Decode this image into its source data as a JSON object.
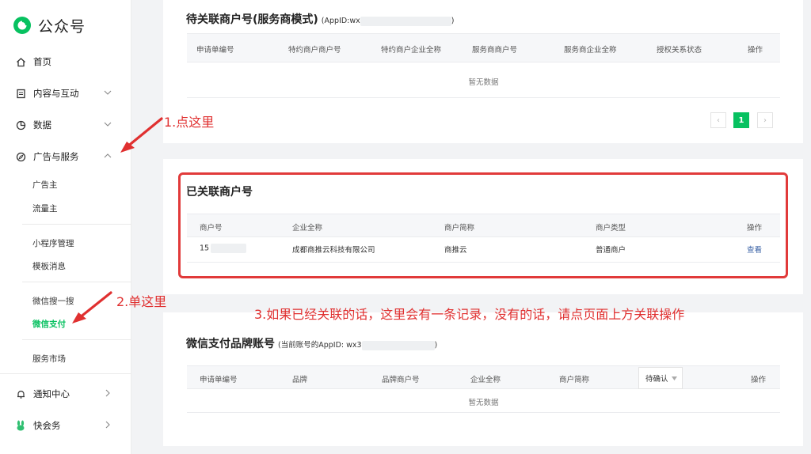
{
  "app": {
    "name": "公众号"
  },
  "sidebar": {
    "items": [
      {
        "label": "首页"
      },
      {
        "label": "内容与互动"
      },
      {
        "label": "数据"
      },
      {
        "label": "广告与服务"
      },
      {
        "label": "通知中心"
      },
      {
        "label": "快会务"
      }
    ],
    "sub_items": [
      {
        "label": "广告主"
      },
      {
        "label": "流量主"
      },
      {
        "label": "小程序管理"
      },
      {
        "label": "模板消息"
      },
      {
        "label": "微信搜一搜"
      },
      {
        "label": "微信支付"
      },
      {
        "label": "服务市场"
      }
    ]
  },
  "pending": {
    "title": "待关联商户号(服务商模式)",
    "note": "(AppID:wx",
    "note_end": ")",
    "columns": [
      "申请单编号",
      "特约商户商户号",
      "特约商户企业全称",
      "服务商商户号",
      "服务商企业全称",
      "授权关系状态",
      "操作"
    ],
    "empty": "暂无数据",
    "pager": {
      "prev": "‹",
      "current": "1",
      "next": "›"
    }
  },
  "linked": {
    "title": "已关联商户号",
    "columns": [
      "商户号",
      "企业全称",
      "商户简称",
      "商户类型",
      "操作"
    ],
    "rows": [
      {
        "merchant_id": "15",
        "company": "成都商推云科技有限公司",
        "short_name": "商推云",
        "type": "普通商户",
        "action": "查看"
      }
    ]
  },
  "brand": {
    "title": "微信支付品牌账号",
    "note": "(当前账号的AppID: wx3",
    "note_end": ")",
    "columns": [
      "申请单编号",
      "品牌",
      "品牌商户号",
      "企业全称",
      "商户简称",
      "操作"
    ],
    "filter": "待确认",
    "empty": "暂无数据"
  },
  "annotations": {
    "step1": "1.点这里",
    "step2": "2.单这里",
    "step3": "3.如果已经关联的话，这里会有一条记录，没有的话，请点页面上方关联操作"
  },
  "colors": {
    "accent": "#07c160",
    "annotation": "#e03030",
    "link": "#3a62a6"
  }
}
